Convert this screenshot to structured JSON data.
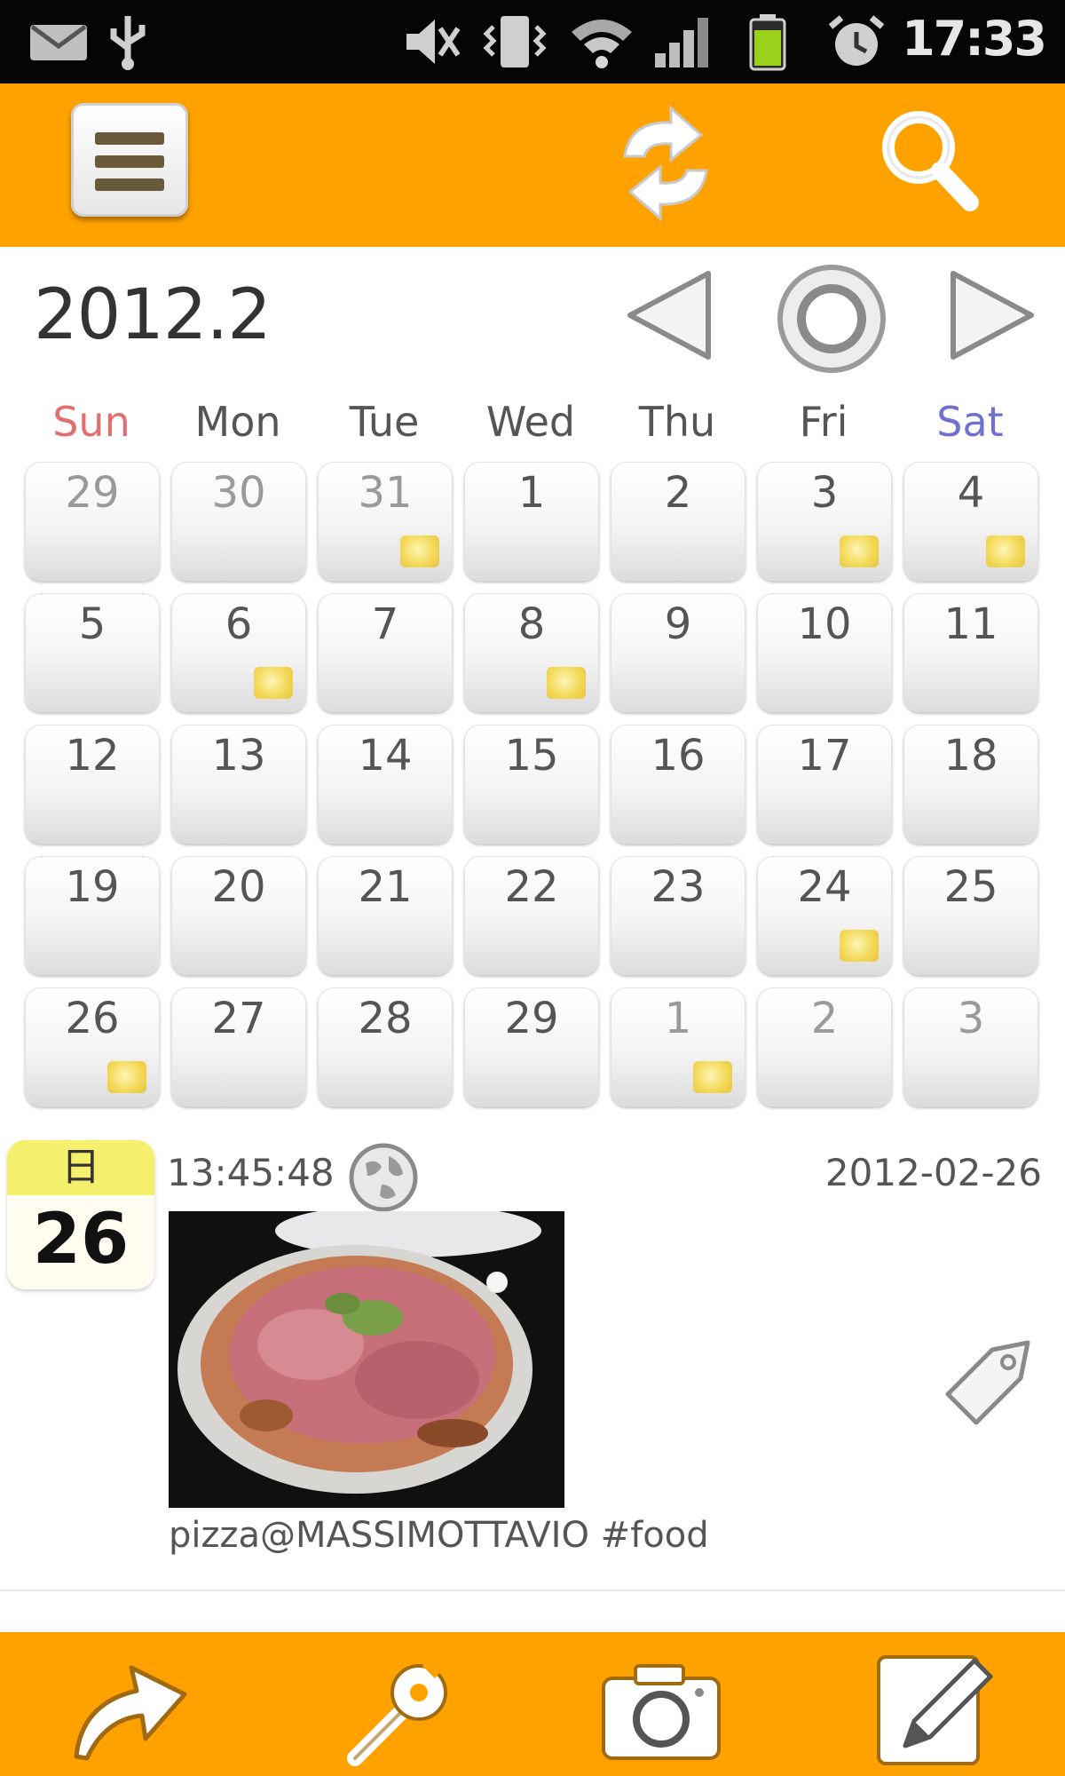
{
  "status_bar": {
    "time": "17:33",
    "icons": [
      "mail-icon",
      "usb-icon",
      "mute-icon",
      "vibrate-icon",
      "wifi-icon",
      "signal-icon",
      "battery-icon",
      "alarm-icon"
    ]
  },
  "top_bar": {
    "accent_color": "#ffa200",
    "buttons": [
      "menu-icon",
      "refresh-icon",
      "search-icon"
    ]
  },
  "calendar": {
    "title": "2012.2",
    "weekdays": [
      "Sun",
      "Mon",
      "Tue",
      "Wed",
      "Thu",
      "Fri",
      "Sat"
    ],
    "weekday_colors": {
      "sun": "#e07070",
      "sat": "#7070d0"
    },
    "weeks": [
      [
        {
          "d": "29",
          "other": true,
          "photo": false
        },
        {
          "d": "30",
          "other": true,
          "photo": false
        },
        {
          "d": "31",
          "other": true,
          "photo": true
        },
        {
          "d": "1",
          "other": false,
          "photo": false
        },
        {
          "d": "2",
          "other": false,
          "photo": false
        },
        {
          "d": "3",
          "other": false,
          "photo": true
        },
        {
          "d": "4",
          "other": false,
          "photo": true
        }
      ],
      [
        {
          "d": "5",
          "other": false,
          "photo": false
        },
        {
          "d": "6",
          "other": false,
          "photo": true
        },
        {
          "d": "7",
          "other": false,
          "photo": false
        },
        {
          "d": "8",
          "other": false,
          "photo": true
        },
        {
          "d": "9",
          "other": false,
          "photo": false
        },
        {
          "d": "10",
          "other": false,
          "photo": false
        },
        {
          "d": "11",
          "other": false,
          "photo": false
        }
      ],
      [
        {
          "d": "12",
          "other": false,
          "photo": false
        },
        {
          "d": "13",
          "other": false,
          "photo": false
        },
        {
          "d": "14",
          "other": false,
          "photo": false
        },
        {
          "d": "15",
          "other": false,
          "photo": false
        },
        {
          "d": "16",
          "other": false,
          "photo": false
        },
        {
          "d": "17",
          "other": false,
          "photo": false
        },
        {
          "d": "18",
          "other": false,
          "photo": false
        }
      ],
      [
        {
          "d": "19",
          "other": false,
          "photo": false
        },
        {
          "d": "20",
          "other": false,
          "photo": false
        },
        {
          "d": "21",
          "other": false,
          "photo": false
        },
        {
          "d": "22",
          "other": false,
          "photo": false
        },
        {
          "d": "23",
          "other": false,
          "photo": false
        },
        {
          "d": "24",
          "other": false,
          "photo": true
        },
        {
          "d": "25",
          "other": false,
          "photo": false
        }
      ],
      [
        {
          "d": "26",
          "other": false,
          "photo": true
        },
        {
          "d": "27",
          "other": false,
          "photo": false
        },
        {
          "d": "28",
          "other": false,
          "photo": false
        },
        {
          "d": "29",
          "other": false,
          "photo": false
        },
        {
          "d": "1",
          "other": true,
          "photo": true
        },
        {
          "d": "2",
          "other": true,
          "photo": false
        },
        {
          "d": "3",
          "other": true,
          "photo": false
        }
      ]
    ]
  },
  "entry": {
    "day_of_week": "日",
    "day": "26",
    "time": "13:45:48",
    "date": "2012-02-26",
    "caption": "pizza@MASSIMOTTAVIO #food",
    "icons": [
      "globe-icon",
      "tag-icon"
    ]
  },
  "bottom_bar": {
    "buttons": [
      "share-arrow-icon",
      "settings-wrench-icon",
      "camera-icon",
      "edit-pencil-icon"
    ]
  }
}
